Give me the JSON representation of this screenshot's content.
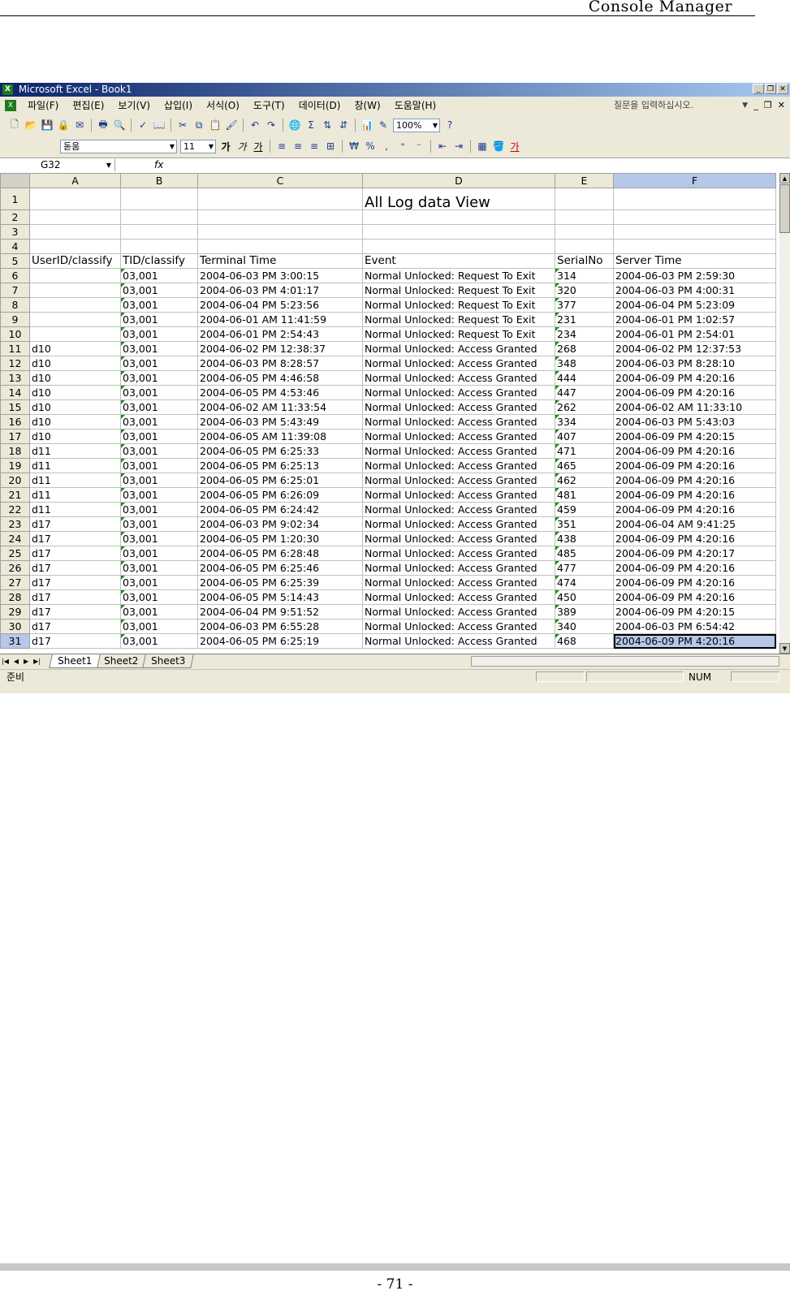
{
  "doc_header": "Console Manager",
  "page_number": "- 71 -",
  "window": {
    "title": "Microsoft Excel - Book1",
    "app_icon": "excel-icon",
    "controls": [
      "minimize-icon",
      "restore-icon",
      "close-icon"
    ]
  },
  "menu": {
    "items": [
      "파일(F)",
      "편집(E)",
      "보기(V)",
      "삽입(I)",
      "서식(O)",
      "도구(T)",
      "데이터(D)",
      "창(W)",
      "도움말(H)"
    ],
    "help_placeholder": "질문을 입력하십시오."
  },
  "toolbar": {
    "zoom": "100%",
    "font_name": "돋움",
    "font_size": "11",
    "bold_label": "가",
    "italic_label": "가",
    "underline_label": "가",
    "currency_label": "₩",
    "percent_label": "%",
    "comma_label": ",",
    "font_color_label": "가",
    "sum_label": "Σ"
  },
  "formula_bar": {
    "name_box": "G32",
    "fx_label": "fx",
    "value": ""
  },
  "sheet": {
    "columns": [
      "A",
      "B",
      "C",
      "D",
      "E",
      "F"
    ],
    "title": "All Log data View",
    "headers": [
      "UserID/classify",
      "TID/classify",
      "Terminal Time",
      "Event",
      "SerialNo",
      "Server Time"
    ],
    "rows": [
      [
        "",
        "03,001",
        "2004-06-03 PM 3:00:15",
        "Normal Unlocked: Request To Exit",
        "314",
        "2004-06-03 PM 2:59:30"
      ],
      [
        "",
        "03,001",
        "2004-06-03 PM 4:01:17",
        "Normal Unlocked: Request To Exit",
        "320",
        "2004-06-03 PM 4:00:31"
      ],
      [
        "",
        "03,001",
        "2004-06-04 PM 5:23:56",
        "Normal Unlocked: Request To Exit",
        "377",
        "2004-06-04 PM 5:23:09"
      ],
      [
        "",
        "03,001",
        "2004-06-01 AM 11:41:59",
        "Normal Unlocked: Request To Exit",
        "231",
        "2004-06-01 PM 1:02:57"
      ],
      [
        "",
        "03,001",
        "2004-06-01 PM 2:54:43",
        "Normal Unlocked: Request To Exit",
        "234",
        "2004-06-01 PM 2:54:01"
      ],
      [
        "d10",
        "03,001",
        "2004-06-02 PM 12:38:37",
        "Normal Unlocked: Access Granted",
        "268",
        "2004-06-02 PM 12:37:53"
      ],
      [
        "d10",
        "03,001",
        "2004-06-03 PM 8:28:57",
        "Normal Unlocked: Access Granted",
        "348",
        "2004-06-03 PM 8:28:10"
      ],
      [
        "d10",
        "03,001",
        "2004-06-05 PM 4:46:58",
        "Normal Unlocked: Access Granted",
        "444",
        "2004-06-09 PM 4:20:16"
      ],
      [
        "d10",
        "03,001",
        "2004-06-05 PM 4:53:46",
        "Normal Unlocked: Access Granted",
        "447",
        "2004-06-09 PM 4:20:16"
      ],
      [
        "d10",
        "03,001",
        "2004-06-02 AM 11:33:54",
        "Normal Unlocked: Access Granted",
        "262",
        "2004-06-02 AM 11:33:10"
      ],
      [
        "d10",
        "03,001",
        "2004-06-03 PM 5:43:49",
        "Normal Unlocked: Access Granted",
        "334",
        "2004-06-03 PM 5:43:03"
      ],
      [
        "d10",
        "03,001",
        "2004-06-05 AM 11:39:08",
        "Normal Unlocked: Access Granted",
        "407",
        "2004-06-09 PM 4:20:15"
      ],
      [
        "d11",
        "03,001",
        "2004-06-05 PM 6:25:33",
        "Normal Unlocked: Access Granted",
        "471",
        "2004-06-09 PM 4:20:16"
      ],
      [
        "d11",
        "03,001",
        "2004-06-05 PM 6:25:13",
        "Normal Unlocked: Access Granted",
        "465",
        "2004-06-09 PM 4:20:16"
      ],
      [
        "d11",
        "03,001",
        "2004-06-05 PM 6:25:01",
        "Normal Unlocked: Access Granted",
        "462",
        "2004-06-09 PM 4:20:16"
      ],
      [
        "d11",
        "03,001",
        "2004-06-05 PM 6:26:09",
        "Normal Unlocked: Access Granted",
        "481",
        "2004-06-09 PM 4:20:16"
      ],
      [
        "d11",
        "03,001",
        "2004-06-05 PM 6:24:42",
        "Normal Unlocked: Access Granted",
        "459",
        "2004-06-09 PM 4:20:16"
      ],
      [
        "d17",
        "03,001",
        "2004-06-03 PM 9:02:34",
        "Normal Unlocked: Access Granted",
        "351",
        "2004-06-04 AM 9:41:25"
      ],
      [
        "d17",
        "03,001",
        "2004-06-05 PM 1:20:30",
        "Normal Unlocked: Access Granted",
        "438",
        "2004-06-09 PM 4:20:16"
      ],
      [
        "d17",
        "03,001",
        "2004-06-05 PM 6:28:48",
        "Normal Unlocked: Access Granted",
        "485",
        "2004-06-09 PM 4:20:17"
      ],
      [
        "d17",
        "03,001",
        "2004-06-05 PM 6:25:46",
        "Normal Unlocked: Access Granted",
        "477",
        "2004-06-09 PM 4:20:16"
      ],
      [
        "d17",
        "03,001",
        "2004-06-05 PM 6:25:39",
        "Normal Unlocked: Access Granted",
        "474",
        "2004-06-09 PM 4:20:16"
      ],
      [
        "d17",
        "03,001",
        "2004-06-05 PM 5:14:43",
        "Normal Unlocked: Access Granted",
        "450",
        "2004-06-09 PM 4:20:16"
      ],
      [
        "d17",
        "03,001",
        "2004-06-04 PM 9:51:52",
        "Normal Unlocked: Access Granted",
        "389",
        "2004-06-09 PM 4:20:15"
      ],
      [
        "d17",
        "03,001",
        "2004-06-03 PM 6:55:28",
        "Normal Unlocked: Access Granted",
        "340",
        "2004-06-03 PM 6:54:42"
      ],
      [
        "d17",
        "03,001",
        "2004-06-05 PM 6:25:19",
        "Normal Unlocked: Access Granted",
        "468",
        "2004-06-09 PM 4:20:16"
      ]
    ],
    "tabs": [
      "Sheet1",
      "Sheet2",
      "Sheet3"
    ],
    "active_tab": "Sheet1"
  },
  "status": {
    "ready": "준비",
    "num": "NUM"
  },
  "colors": {
    "title_bar_start": "#0a246a",
    "title_bar_end": "#a6caf0",
    "selection": "#b6c7e8",
    "ui_face": "#ece9d8"
  }
}
